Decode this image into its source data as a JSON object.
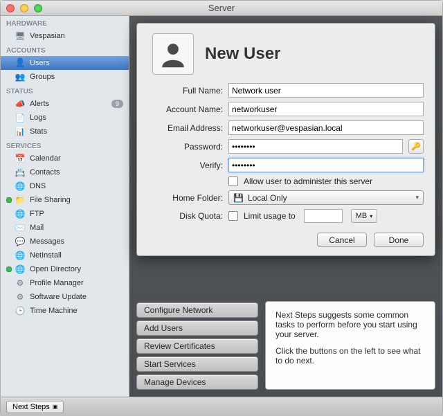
{
  "window": {
    "title": "Server"
  },
  "sidebar": {
    "hardware_header": "HARDWARE",
    "hardware_item": "Vespasian",
    "accounts_header": "ACCOUNTS",
    "users": "Users",
    "groups": "Groups",
    "status_header": "STATUS",
    "alerts": "Alerts",
    "alerts_badge": "9",
    "logs": "Logs",
    "stats": "Stats",
    "services_header": "SERVICES",
    "services": [
      "Calendar",
      "Contacts",
      "DNS",
      "File Sharing",
      "FTP",
      "Mail",
      "Messages",
      "NetInstall",
      "Open Directory",
      "Profile Manager",
      "Software Update",
      "Time Machine"
    ]
  },
  "sheet": {
    "title": "New User",
    "full_name_label": "Full Name:",
    "full_name_value": "Network user",
    "account_name_label": "Account Name:",
    "account_name_value": "networkuser",
    "email_label": "Email Address:",
    "email_value": "networkuser@vespasian.local",
    "password_label": "Password:",
    "password_value": "••••••••",
    "verify_label": "Verify:",
    "verify_value": "••••••••",
    "admin_label": "Allow user to administer this server",
    "home_folder_label": "Home Folder:",
    "home_folder_value": "Local Only",
    "disk_quota_label": "Disk Quota:",
    "limit_label": "Limit usage to",
    "unit": "MB",
    "cancel": "Cancel",
    "done": "Done"
  },
  "actions": [
    "Configure Network",
    "Add Users",
    "Review Certificates",
    "Start Services",
    "Manage Devices"
  ],
  "tips_line1": "Next Steps suggests some common tasks to perform before you start using your server.",
  "tips_line2": "Click the buttons on the left to see what to do next.",
  "bottom": {
    "next_steps": "Next Steps"
  }
}
